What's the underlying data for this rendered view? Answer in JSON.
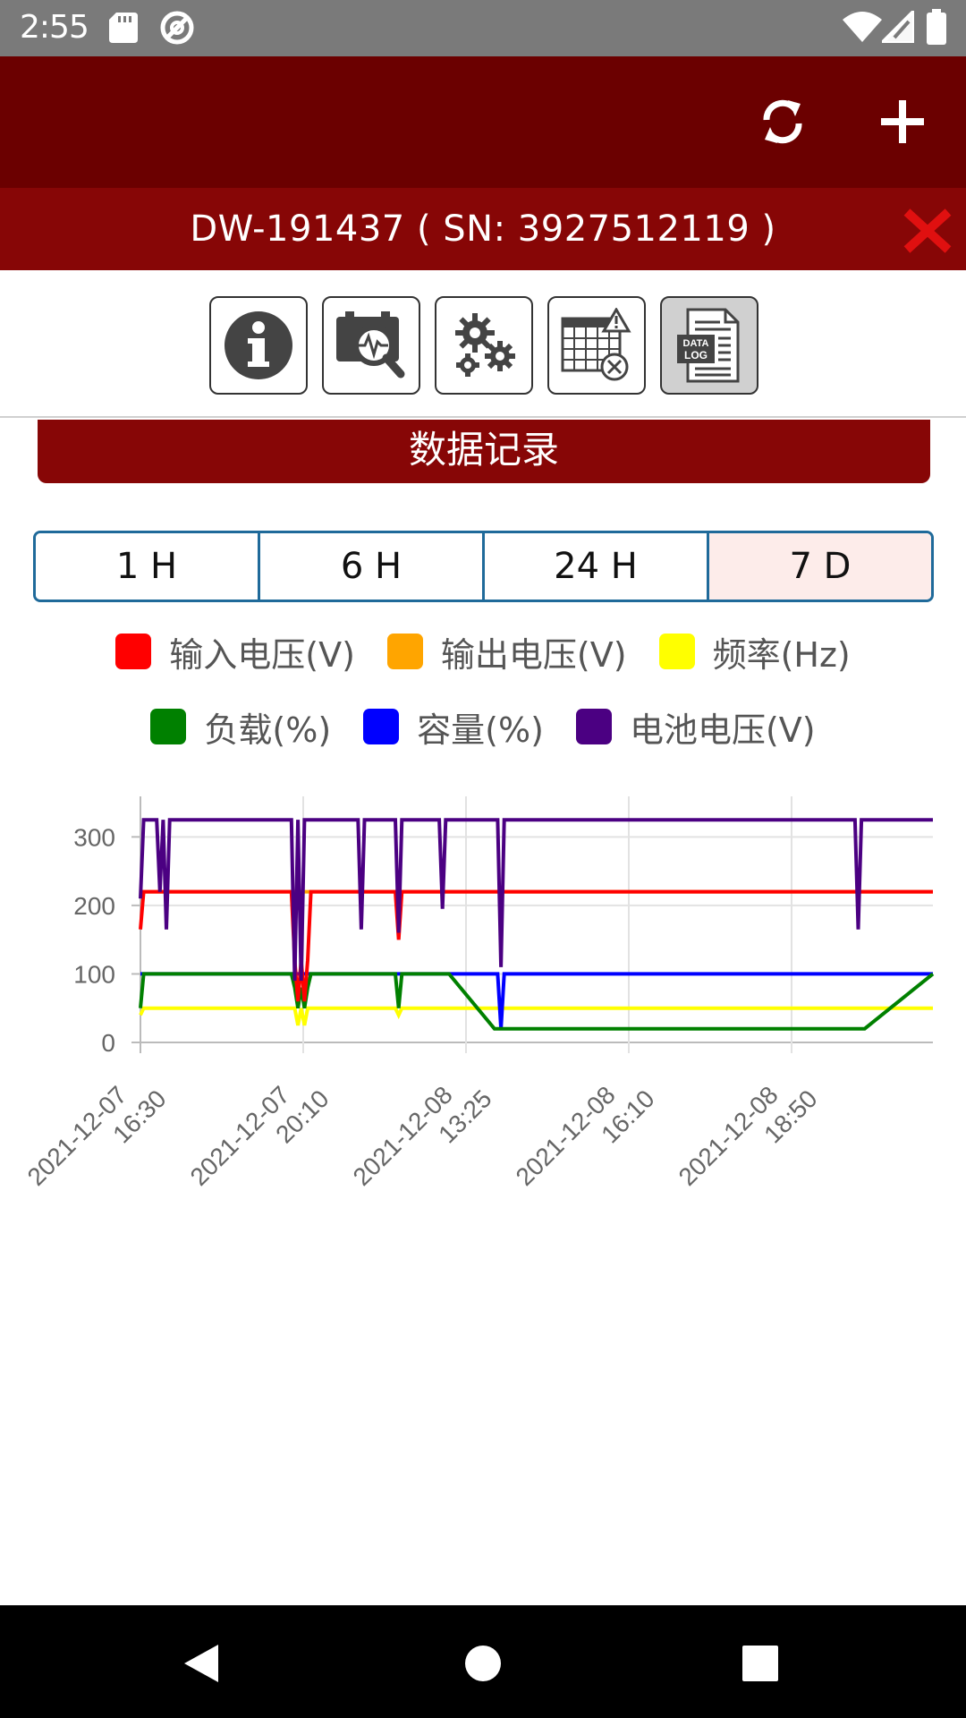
{
  "status_bar": {
    "time": "2:55",
    "icons": [
      "sd-card-icon",
      "at-sign-icon",
      "wifi-icon",
      "signal-icon",
      "battery-icon"
    ]
  },
  "app_bar": {
    "actions": [
      "refresh-icon",
      "add-icon"
    ]
  },
  "device": {
    "title": "DW-191437 ( SN: 3927512119 )",
    "close_icon": "close-icon",
    "close_color": "#e01010"
  },
  "toolbar": {
    "buttons": [
      "info-icon",
      "monitor-search-icon",
      "settings-gears-icon",
      "schedule-calendar-icon",
      "data-log-icon"
    ],
    "data_log_badge": [
      "DATA",
      "LOG"
    ],
    "active": "data-log-icon"
  },
  "section": {
    "title": "数据记录"
  },
  "range_tabs": {
    "labels": [
      "1 H",
      "6 H",
      "24 H",
      "7 D"
    ],
    "selected": "7 D"
  },
  "colors": {
    "primary": "#6b0000",
    "accent": "#870606",
    "tab_border": "#1f6a9a"
  },
  "chart_data": {
    "type": "line",
    "x_ticks": [
      {
        "date": "2021-12-07",
        "time": "16:30"
      },
      {
        "date": "2021-12-07",
        "time": "20:10"
      },
      {
        "date": "2021-12-08",
        "time": "13:25"
      },
      {
        "date": "2021-12-08",
        "time": "16:10"
      },
      {
        "date": "2021-12-08",
        "time": "18:50"
      }
    ],
    "y_ticks": [
      0,
      100,
      200,
      300
    ],
    "ylim": [
      0,
      325
    ],
    "grid": true,
    "legend_position": "top",
    "x": [
      0,
      0.1,
      0.5,
      0.6,
      0.7,
      0.8,
      0.9,
      1.0,
      1.1,
      1.2,
      1.3,
      1.4,
      4.65,
      4.75,
      4.85,
      4.95,
      5.05,
      5.15,
      5.25,
      5.35,
      5.45,
      6.7,
      6.8,
      6.9,
      7.0,
      7.1,
      7.85,
      7.95,
      8.05,
      8.15,
      8.25,
      9.2,
      9.3,
      9.4,
      9.5,
      10.9,
      11.0,
      11.1,
      11.2,
      22.0,
      22.1,
      22.2,
      22.3,
      24.4
    ],
    "series": [
      {
        "name": "输入电压(V)",
        "color": "#ff0000",
        "values": [
          165,
          220,
          220,
          220,
          220,
          220,
          220,
          220,
          220,
          220,
          220,
          220,
          220,
          120,
          60,
          120,
          60,
          120,
          220,
          220,
          220,
          220,
          220,
          220,
          220,
          220,
          220,
          150,
          220,
          220,
          220,
          220,
          220,
          220,
          220,
          220,
          220,
          220,
          220,
          220,
          220,
          220,
          220,
          220
        ]
      },
      {
        "name": "输出电压(V)",
        "color": "#ffa500",
        "values": [
          220,
          220,
          220,
          220,
          220,
          220,
          220,
          220,
          220,
          220,
          220,
          220,
          220,
          220,
          220,
          220,
          220,
          220,
          220,
          220,
          220,
          220,
          220,
          220,
          220,
          220,
          220,
          220,
          220,
          220,
          220,
          220,
          220,
          220,
          220,
          220,
          220,
          220,
          220,
          220,
          220,
          220,
          220,
          220
        ]
      },
      {
        "name": "频率(Hz)",
        "color": "#ffff00",
        "values": [
          40,
          50,
          50,
          50,
          50,
          50,
          50,
          50,
          50,
          50,
          50,
          50,
          50,
          50,
          25,
          50,
          25,
          50,
          50,
          50,
          50,
          50,
          50,
          50,
          50,
          50,
          50,
          40,
          50,
          50,
          50,
          50,
          50,
          50,
          50,
          50,
          50,
          50,
          50,
          50,
          50,
          50,
          50,
          50
        ]
      },
      {
        "name": "负载(%)",
        "color": "#008000",
        "values": [
          50,
          100,
          100,
          100,
          100,
          100,
          100,
          100,
          100,
          100,
          100,
          100,
          100,
          80,
          50,
          80,
          50,
          80,
          100,
          100,
          100,
          100,
          100,
          100,
          100,
          100,
          100,
          50,
          100,
          100,
          100,
          100,
          100,
          100,
          100,
          20,
          20,
          20,
          20,
          20,
          20,
          20,
          20,
          100
        ]
      },
      {
        "name": "容量(%)",
        "color": "#0000ff",
        "values": [
          100,
          100,
          100,
          100,
          100,
          100,
          100,
          100,
          100,
          100,
          100,
          100,
          100,
          100,
          100,
          100,
          100,
          100,
          100,
          100,
          100,
          100,
          100,
          100,
          100,
          100,
          100,
          100,
          100,
          100,
          100,
          100,
          100,
          100,
          100,
          100,
          100,
          20,
          100,
          100,
          100,
          100,
          100,
          100
        ]
      },
      {
        "name": "电池电压(V)",
        "color": "#4b0082",
        "values": [
          210,
          325,
          325,
          220,
          325,
          165,
          325,
          325,
          325,
          325,
          325,
          325,
          325,
          90,
          325,
          90,
          325,
          325,
          325,
          325,
          325,
          325,
          165,
          325,
          325,
          325,
          325,
          160,
          325,
          325,
          325,
          325,
          195,
          325,
          325,
          325,
          325,
          110,
          325,
          325,
          165,
          325,
          325,
          325
        ]
      }
    ]
  }
}
